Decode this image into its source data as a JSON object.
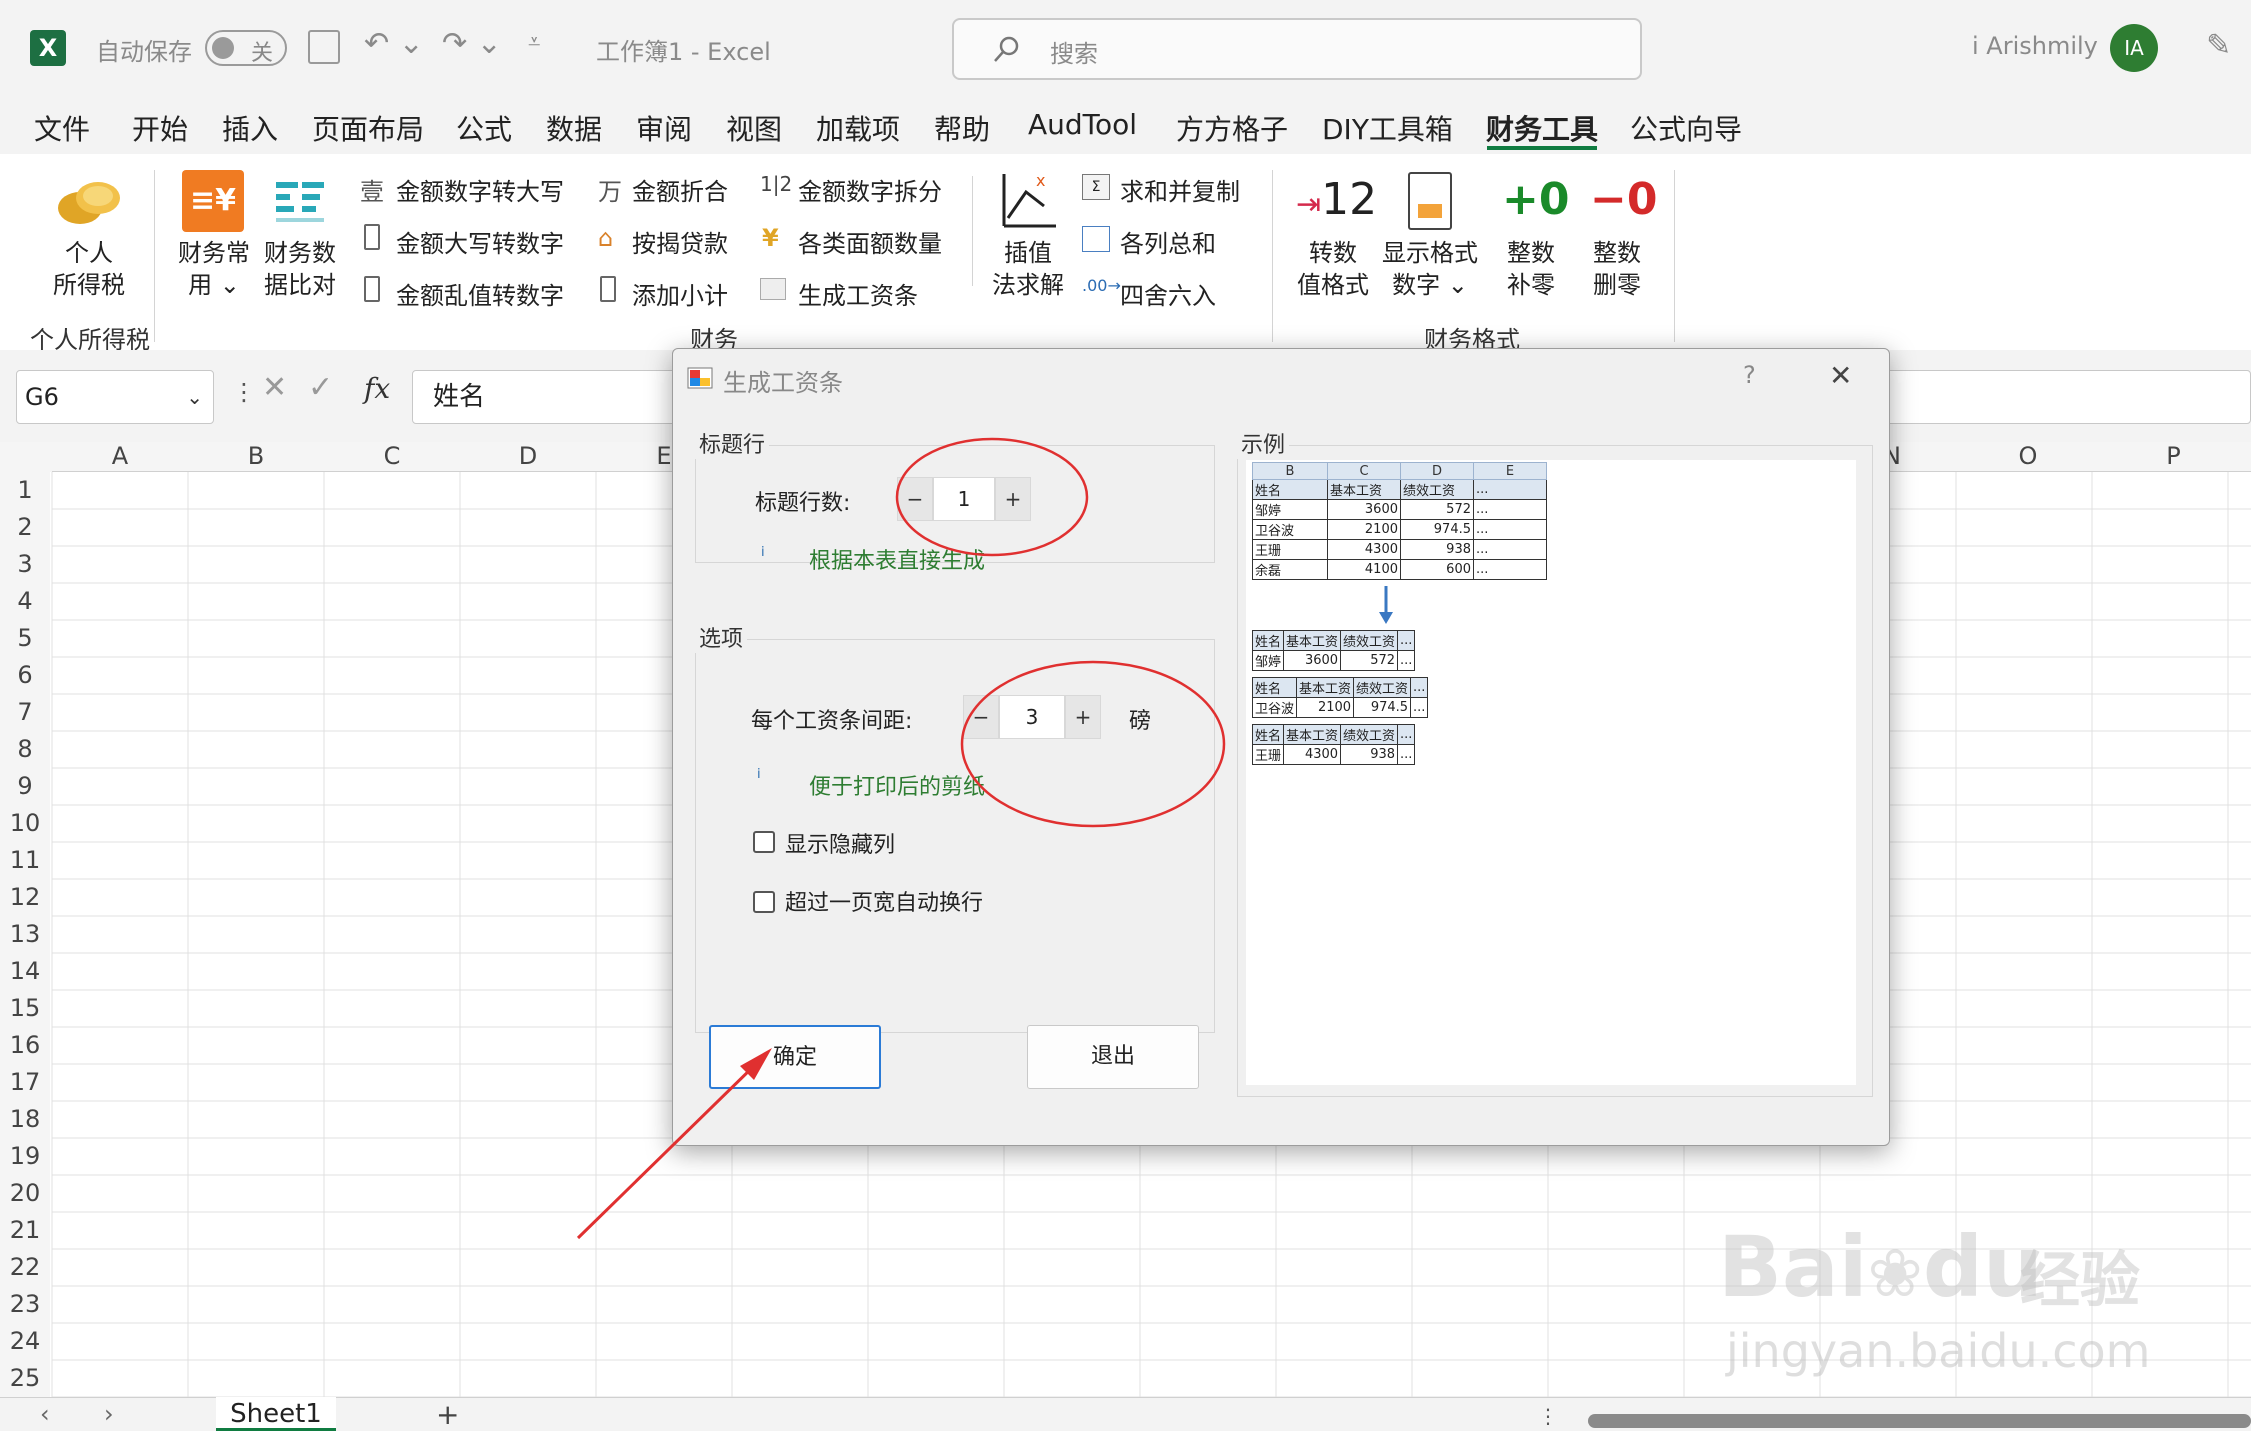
{
  "titlebar": {
    "autosave_label": "自动保存",
    "autosave_state": "关",
    "doc_title": "工作簿1  -  Excel",
    "search_placeholder": "搜索",
    "user_name": "i Arishmily",
    "user_initials": "IA"
  },
  "menu": {
    "tabs": [
      "文件",
      "开始",
      "插入",
      "页面布局",
      "公式",
      "数据",
      "审阅",
      "视图",
      "加载项",
      "帮助",
      "AudTool",
      "方方格子",
      "DIY工具箱",
      "财务工具",
      "公式向导"
    ],
    "active_tab": "财务工具"
  },
  "ribbon": {
    "personal_tax": {
      "line1": "个人",
      "line2": "所得税",
      "group": "个人所得税"
    },
    "finance_common": {
      "line1": "财务常",
      "line2": "用 ⌄"
    },
    "finance_compare": {
      "line1": "财务数",
      "line2": "据比对"
    },
    "col1": [
      "金额数字转大写",
      "金额大写转数字",
      "金额乱值转数字"
    ],
    "col2": [
      "金额折合",
      "按揭贷款",
      "添加小计"
    ],
    "col3": [
      "金额数字拆分",
      "各类面额数量",
      "生成工资条"
    ],
    "interp": {
      "line1": "插值",
      "line2": "法求解"
    },
    "col4": [
      "求和并复制",
      "各列总和",
      "四舍六入"
    ],
    "finance_group": "财务",
    "convert_fmt": {
      "glyph": "+12",
      "line1": "转数",
      "line2": "值格式"
    },
    "display_fmt": {
      "line1": "显示格式",
      "line2": "数字 ⌄"
    },
    "pad_zero": {
      "glyph": "+0",
      "line1": "整数",
      "line2": "补零"
    },
    "remove_zero": {
      "glyph": "−0",
      "line1": "整数",
      "line2": "删零"
    },
    "format_group": "财务格式"
  },
  "formula_bar": {
    "cell_ref": "G6",
    "content": "姓名",
    "fx": "fx"
  },
  "grid": {
    "columns": [
      "A",
      "B",
      "C",
      "D",
      "E",
      "N",
      "O",
      "P"
    ],
    "rows": [
      "1",
      "2",
      "3",
      "4",
      "5",
      "6",
      "7",
      "8",
      "9",
      "10",
      "11",
      "12",
      "13",
      "14",
      "15",
      "16",
      "17",
      "18",
      "19",
      "20",
      "21",
      "22",
      "23",
      "24",
      "25"
    ]
  },
  "sheet": {
    "tab": "Sheet1",
    "add": "+"
  },
  "dialog": {
    "title": "生成工资条",
    "help": "?",
    "close": "✕",
    "header_group": "标题行",
    "header_rows_label": "标题行数:",
    "header_rows_value": "1",
    "header_hint": "根据本表直接生成",
    "options_group": "选项",
    "spacing_label": "每个工资条间距:",
    "spacing_value": "3",
    "spacing_unit": "磅",
    "spacing_hint": "便于打印后的剪纸",
    "show_hidden_cols": "显示隐藏列",
    "auto_wrap": "超过一页宽自动换行",
    "ok": "确定",
    "exit": "退出",
    "example_group": "示例",
    "example": {
      "letters": [
        "B",
        "C",
        "D",
        "E"
      ],
      "headers": [
        "姓名",
        "基本工资",
        "绩效工资",
        "..."
      ],
      "rows": [
        [
          "邹婷",
          "3600",
          "572",
          "..."
        ],
        [
          "卫谷波",
          "2100",
          "974.5",
          "..."
        ],
        [
          "王珊",
          "4300",
          "938",
          "..."
        ],
        [
          "余磊",
          "4100",
          "600",
          "..."
        ]
      ],
      "slips": [
        [
          "邹婷",
          "3600",
          "572",
          "..."
        ],
        [
          "卫谷波",
          "2100",
          "974.5",
          "..."
        ],
        [
          "王珊",
          "4300",
          "938",
          "..."
        ]
      ]
    }
  },
  "watermark": {
    "brand": "Bai",
    "brand2": "du",
    "cn": "经验",
    "url": "jingyan.baidu.com"
  }
}
